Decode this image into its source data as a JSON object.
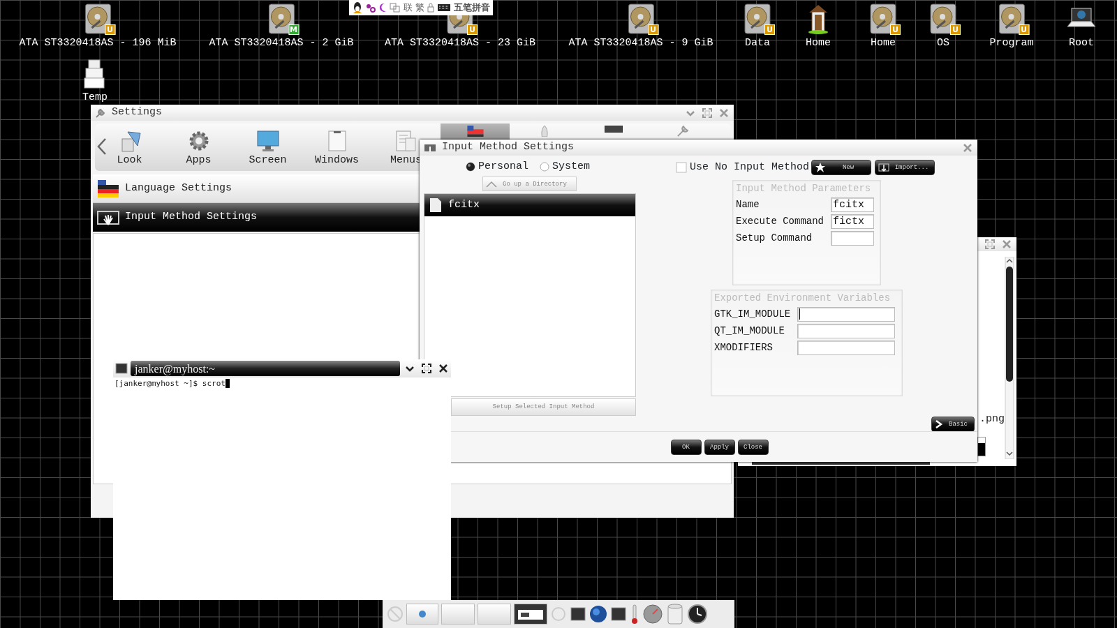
{
  "desktop_icons": [
    {
      "label": "ATA ST3320418AS - 196 MiB",
      "kind": "drive",
      "badge": "U"
    },
    {
      "label": "ATA ST3320418AS - 2 GiB",
      "kind": "drive",
      "badge": "M"
    },
    {
      "label": "ATA ST3320418AS - 23 GiB",
      "kind": "drive",
      "badge": "U"
    },
    {
      "label": "ATA ST3320418AS - 9 GiB",
      "kind": "drive",
      "badge": "U"
    },
    {
      "label": "Data",
      "kind": "drive",
      "badge": "U"
    },
    {
      "label": "Home",
      "kind": "home"
    },
    {
      "label": "Home",
      "kind": "drive",
      "badge": "U"
    },
    {
      "label": "OS",
      "kind": "drive",
      "badge": "U"
    },
    {
      "label": "Program",
      "kind": "drive",
      "badge": "U"
    },
    {
      "label": "Root",
      "kind": "laptop"
    },
    {
      "label": "Temp",
      "kind": "files"
    }
  ],
  "ime_bar": {
    "toggles": [
      "联",
      "繁"
    ],
    "mode": "五笔拼音"
  },
  "settings_window": {
    "title": "Settings",
    "toolbar": [
      {
        "label": "Look",
        "kind": "look",
        "selected": false
      },
      {
        "label": "Apps",
        "kind": "apps",
        "selected": false
      },
      {
        "label": "Screen",
        "kind": "screen",
        "selected": false
      },
      {
        "label": "Windows",
        "kind": "windows",
        "selected": false
      },
      {
        "label": "Menus",
        "kind": "menus",
        "selected": false
      },
      {
        "kind": "flag",
        "selected": true
      },
      {
        "kind": "rocket",
        "selected": false
      },
      {
        "kind": "monitor",
        "selected": false
      },
      {
        "kind": "tools",
        "selected": false
      }
    ],
    "sidebar": {
      "items": [
        {
          "label": "Language Settings",
          "kind": "flag",
          "selected": false
        },
        {
          "label": "Input Method Settings",
          "kind": "hand",
          "selected": true
        }
      ]
    }
  },
  "background_window": {
    "file_suffix": ".png"
  },
  "im_window": {
    "title": "Input Method Settings",
    "scope": [
      {
        "label": "Personal",
        "selected": true
      },
      {
        "label": "System",
        "selected": false
      }
    ],
    "go_up_button": "Go up a Directory",
    "methods": [
      {
        "label": "fcitx",
        "selected": true
      }
    ],
    "setup_button": "Setup Selected Input Method",
    "use_no_input_method": {
      "label": "Use No Input Method",
      "checked": false
    },
    "actions": [
      {
        "label": "New",
        "kind": "star"
      },
      {
        "label": "Import...",
        "kind": "import"
      }
    ],
    "parameters": {
      "title": "Input Method Parameters",
      "fields": [
        {
          "label": "Name",
          "value": "fcitx"
        },
        {
          "label": "Execute Command",
          "value": "fictx"
        },
        {
          "label": "Setup Command"
        }
      ]
    },
    "environment": {
      "title": "Exported Environment Variables",
      "fields": [
        {
          "label": "GTK_IM_MODULE",
          "focused": true
        },
        {
          "label": "QT_IM_MODULE",
          "focused": false
        },
        {
          "label": "XMODIFIERS",
          "focused": false
        }
      ]
    },
    "mode_button": "Basic",
    "buttons": [
      "OK",
      "Apply",
      "Close"
    ]
  },
  "terminal": {
    "title": "janker@myhost:~",
    "lines": [
      "[janker@myhost ~]$ scrot"
    ]
  }
}
